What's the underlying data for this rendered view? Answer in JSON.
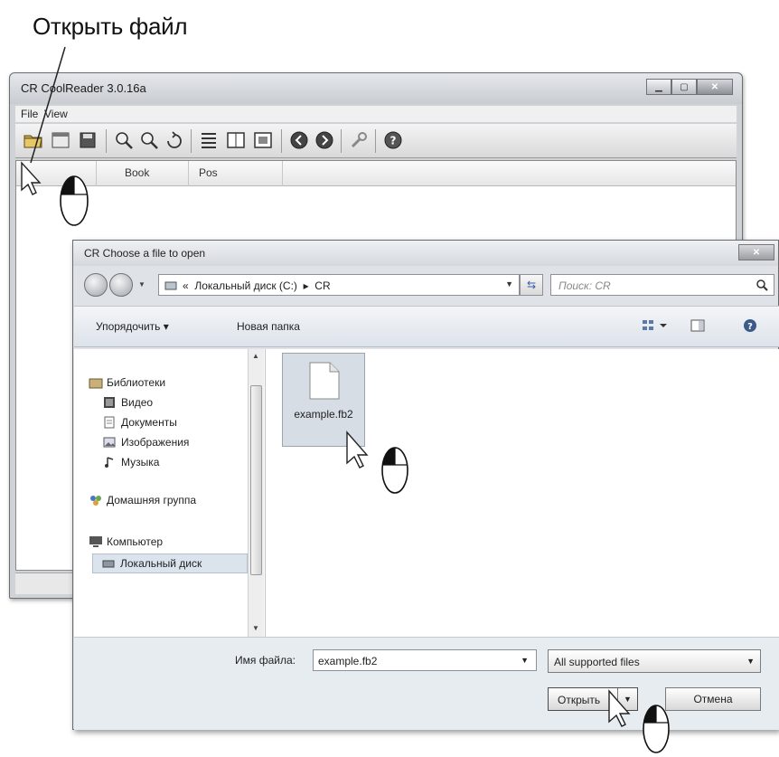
{
  "annotation": {
    "text": "Открыть файл"
  },
  "main_window": {
    "title": "CR CoolReader 3.0.16a",
    "menu": [
      "File",
      "View"
    ],
    "toolbar_icons": [
      "open-file-icon",
      "recent-books-icon",
      "save-icon",
      "zoom-in-icon",
      "zoom-out-icon",
      "rotate-icon",
      "toc-icon",
      "one-page-icon",
      "fullscreen-icon",
      "back-icon",
      "forward-icon",
      "settings-icon",
      "help-icon"
    ],
    "columns": [
      "Book",
      "Pos"
    ]
  },
  "dialog": {
    "title": "CR Choose a file to open",
    "address_prefix": "«",
    "address_path": [
      "Локальный диск (C:)",
      "CR"
    ],
    "address_separator": "▸",
    "search_placeholder": "Поиск: CR",
    "toolbar": {
      "organize": "Упорядочить ▾",
      "new_folder": "Новая папка"
    },
    "nav": {
      "libraries": "Библиотеки",
      "video": "Видео",
      "documents": "Документы",
      "images": "Изображения",
      "music": "Музыка",
      "homegroup": "Домашняя группа",
      "computer": "Компьютер",
      "local_disk": "Локальный диск"
    },
    "files": [
      {
        "name": "example.fb2",
        "selected": true
      }
    ],
    "filename_label": "Имя файла:",
    "filename_value": "example.fb2",
    "filetype": "All supported files",
    "open_button": "Открыть",
    "cancel_button": "Отмена"
  },
  "colors": {
    "selection": "#d7dde4",
    "window_frame": "#cfd3d8",
    "dialog_bg": "#dfe3e8"
  }
}
